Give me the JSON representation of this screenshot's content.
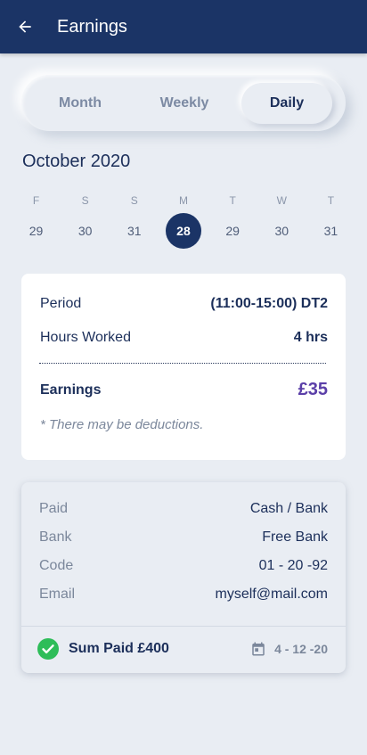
{
  "appbar": {
    "title": "Earnings",
    "back_icon": "arrow-left-icon"
  },
  "tabs": [
    {
      "label": "Month",
      "selected": false
    },
    {
      "label": "Weekly",
      "selected": false
    },
    {
      "label": "Daily",
      "selected": true
    }
  ],
  "calendar": {
    "month_label": "October 2020",
    "days": [
      {
        "dow": "F",
        "num": "29",
        "selected": false
      },
      {
        "dow": "S",
        "num": "30",
        "selected": false
      },
      {
        "dow": "S",
        "num": "31",
        "selected": false
      },
      {
        "dow": "M",
        "num": "28",
        "selected": true
      },
      {
        "dow": "T",
        "num": "29",
        "selected": false
      },
      {
        "dow": "W",
        "num": "30",
        "selected": false
      },
      {
        "dow": "T",
        "num": "31",
        "selected": false
      }
    ]
  },
  "summary": {
    "period_label": "Period",
    "period_value": "(11:00-15:00) DT2",
    "hours_label": "Hours Worked",
    "hours_value": "4 hrs",
    "earnings_label": "Earnings",
    "earnings_value": "£35",
    "note": "* There may be deductions."
  },
  "payment": {
    "paid_label": "Paid",
    "paid_value": "Cash / Bank",
    "bank_label": "Bank",
    "bank_value": "Free Bank",
    "code_label": "Code",
    "code_value": "01 - 20 -92",
    "email_label": "Email",
    "email_value": "myself@mail.com",
    "sum_text": "Sum Paid £400",
    "date_text": "4 - 12 -20",
    "check_icon": "check-circle-icon",
    "calendar_icon": "calendar-icon"
  },
  "colors": {
    "primary": "#1b3466",
    "background": "#e9edf3",
    "accent": "#5b3fa8",
    "success": "#2ebd59"
  }
}
